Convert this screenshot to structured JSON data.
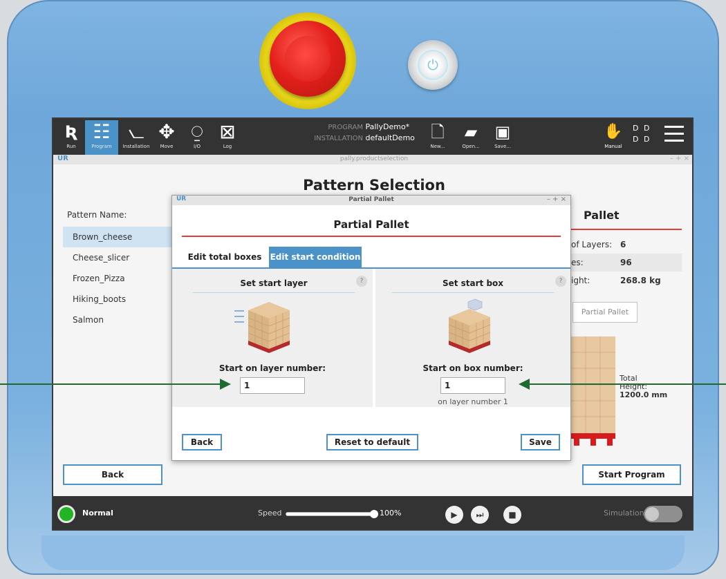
{
  "topbar": {
    "nav": [
      {
        "label": "Run",
        "icon": "ur-logo-icon"
      },
      {
        "label": "Program",
        "icon": "program-tree-icon"
      },
      {
        "label": "Installation",
        "icon": "robot-arm-icon"
      },
      {
        "label": "Move",
        "icon": "move-arrows-icon"
      },
      {
        "label": "I/O",
        "icon": "io-icon"
      },
      {
        "label": "Log",
        "icon": "log-icon"
      }
    ],
    "active_tab": "Program",
    "program_key": "PROGRAM",
    "program_value": "PallyDemo*",
    "installation_key": "INSTALLATION",
    "installation_value": "defaultDemo",
    "new_label": "New...",
    "open_label": "Open...",
    "save_label": "Save...",
    "manual_label": "Manual",
    "user_line1": "D D",
    "user_line2": "D D"
  },
  "subbar": {
    "logo": "UR",
    "title": "pally.productselection",
    "controls": "– + ×"
  },
  "main": {
    "title": "Pattern Selection",
    "pattern_label": "Pattern Name:",
    "patterns": [
      "Brown_cheese",
      "Cheese_slicer",
      "Frozen_Pizza",
      "Hiking_boots",
      "Salmon"
    ],
    "selected_pattern": "Brown_cheese",
    "right_panel": {
      "title": "Pallet",
      "rows": [
        {
          "key": "of Layers:",
          "value": "6"
        },
        {
          "key": "es:",
          "value": "96"
        },
        {
          "key": "ight:",
          "value": "268.8 kg"
        }
      ],
      "partial_button": "Partial Pallet",
      "total_height_label": "Total Height:",
      "total_height_value": "1200.0 mm"
    },
    "back_label": "Back",
    "start_program_label": "Start Program"
  },
  "dialog": {
    "window_logo": "UR",
    "window_title": "Partial Pallet",
    "window_controls": "– + ×",
    "heading": "Partial Pallet",
    "tabs": [
      "Edit total boxes",
      "Edit start condition"
    ],
    "active_tab": "Edit start condition",
    "left": {
      "title": "Set start layer",
      "help": "?",
      "prompt": "Start on layer number:",
      "value": "1"
    },
    "right": {
      "title": "Set start box",
      "help": "?",
      "prompt": "Start on box number:",
      "value": "1",
      "note": "on layer number 1"
    },
    "back_label": "Back",
    "reset_label": "Reset to default",
    "save_label": "Save"
  },
  "bottombar": {
    "status": "Normal",
    "status_color": "#22b422",
    "speed_label": "Speed",
    "speed_value": "100%",
    "speed_fraction": 1.0,
    "simulation_label": "Simulation",
    "simulation_on": false
  },
  "colors": {
    "accent": "#4a92c8",
    "heading_rule": "#e23b3b",
    "annotation_arrow": "#1d6b30",
    "topbar": "#333333"
  }
}
